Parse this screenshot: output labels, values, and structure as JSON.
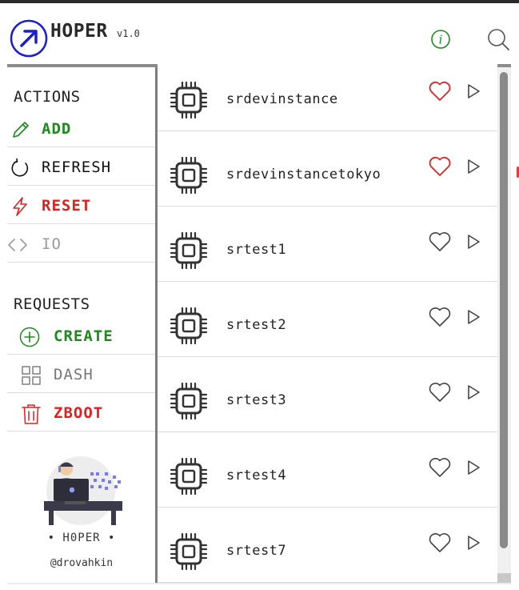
{
  "app": {
    "title": "HOPER",
    "version": "v1.0"
  },
  "colors": {
    "accent_blue": "#1a1fd6",
    "green": "#1e8a1e",
    "red": "#e02020",
    "gray": "#8a8a8a",
    "heart_active": "#e02424"
  },
  "header": {
    "info_icon": "info-icon",
    "search_icon": "search-icon"
  },
  "sidebar": {
    "actions_title": "ACTIONS",
    "actions": [
      {
        "label": "ADD",
        "icon": "pencil-icon",
        "color": "#1e8a1e"
      },
      {
        "label": "REFRESH",
        "icon": "refresh-icon",
        "color": "#111111"
      },
      {
        "label": "RESET",
        "icon": "lightning-icon",
        "color": "#e02020"
      },
      {
        "label": "IO",
        "icon": "code-icon",
        "color": "#9a9a9a"
      }
    ],
    "requests_title": "REQUESTS",
    "requests": [
      {
        "label": "CREATE",
        "icon": "plus-circle-icon",
        "color": "#1e8a1e"
      },
      {
        "label": "DASH",
        "icon": "dashboard-icon",
        "color": "#777777"
      },
      {
        "label": "ZBOOT",
        "icon": "trash-icon",
        "color": "#e02020"
      }
    ],
    "brand": "• H0PER •",
    "handle": "@drovahkin"
  },
  "instances": [
    {
      "name": "srdevinstance",
      "favorite": true
    },
    {
      "name": "srdevinstancetokyo",
      "favorite": true
    },
    {
      "name": "srtest1",
      "favorite": false
    },
    {
      "name": "srtest2",
      "favorite": false
    },
    {
      "name": "srtest3",
      "favorite": false
    },
    {
      "name": "srtest4",
      "favorite": false
    },
    {
      "name": "srtest7",
      "favorite": false
    }
  ]
}
